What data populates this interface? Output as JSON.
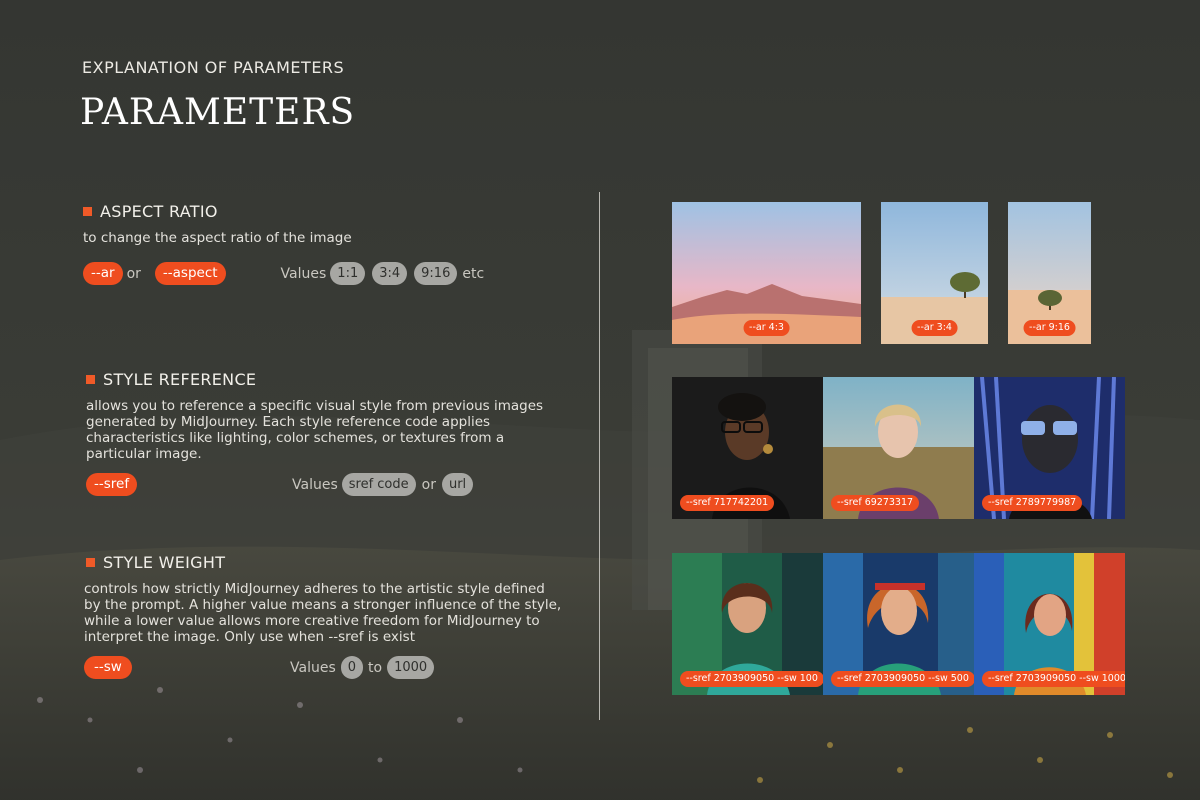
{
  "header": {
    "kicker": "EXPLANATION OF PARAMETERS",
    "title": "PARAMETERS"
  },
  "aspect_ratio": {
    "heading": "ASPECT RATIO",
    "description": "to change the aspect ratio of the image",
    "param_short": "--ar",
    "or_label": "or",
    "param_long": "--aspect",
    "values_label": "Values",
    "values": [
      "1:1",
      "3:4",
      "9:16"
    ],
    "etc_label": "etc"
  },
  "style_reference": {
    "heading": "STYLE REFERENCE",
    "description_lines": [
      "allows you to reference a specific visual style from previous images",
      "generated by MidJourney. Each style reference code applies",
      "characteristics like lighting, color schemes, or textures from a",
      "particular image."
    ],
    "param": "--sref",
    "values_label": "Values",
    "value_a": "sref code",
    "or_label": "or",
    "value_b": "url"
  },
  "style_weight": {
    "heading": "STYLE WEIGHT",
    "description_lines": [
      "controls how strictly MidJourney adheres to the artistic style defined",
      "by the prompt. A higher value means a stronger influence of the style,",
      "while a lower value allows more creative freedom for MidJourney to",
      "interpret the image. Only use when --sref is exist"
    ],
    "param": "--sw",
    "values_label": "Values",
    "value_min": "0",
    "to_label": "to",
    "value_max": "1000"
  },
  "aspect_examples": [
    {
      "caption": "--ar 4:3"
    },
    {
      "caption": "--ar 3:4"
    },
    {
      "caption": "--ar 9:16"
    }
  ],
  "sref_examples": [
    {
      "caption": "--sref 717742201"
    },
    {
      "caption": "--sref 69273317"
    },
    {
      "caption": "--sref 2789779987"
    }
  ],
  "sw_examples": [
    {
      "caption": "--sref 2703909050 --sw 100"
    },
    {
      "caption": "--sref 2703909050 --sw 500"
    },
    {
      "caption": "--sref 2703909050 --sw 1000"
    }
  ],
  "colors": {
    "accent": "#ef4d1f",
    "value_pill": "#a7a7a3",
    "background": "#383a35"
  }
}
